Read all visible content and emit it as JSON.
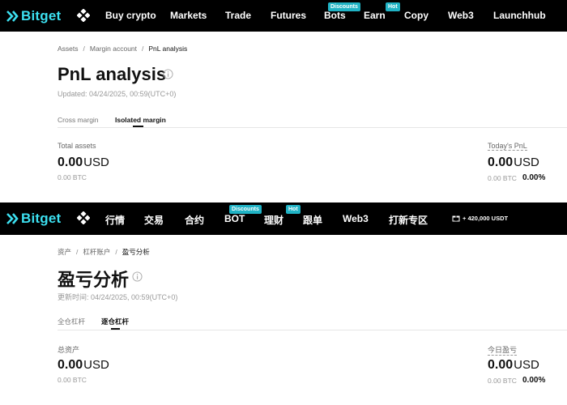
{
  "brand": {
    "name": "Bitget",
    "accent_color": "#3ce0f0",
    "badge_color": "#20b3c5"
  },
  "english": {
    "nav": {
      "items": [
        "Buy crypto",
        "Markets",
        "Trade",
        "Futures",
        "Bots",
        "Earn",
        "Copy",
        "Web3",
        "Launchhub"
      ],
      "bots_badge": "Discounts",
      "earn_badge": "Hot"
    },
    "breadcrumb": [
      "Assets",
      "Margin account",
      "PnL analysis"
    ],
    "title": "PnL analysis",
    "updated": "Updated: 04/24/2025, 00:59(UTC+0)",
    "tabs": [
      "Cross margin",
      "Isolated margin"
    ],
    "active_tab": "Isolated margin",
    "total_assets": {
      "label": "Total assets",
      "value": "0.00",
      "unit": "USD",
      "btc": "0.00 BTC"
    },
    "todays_pnl": {
      "label": "Today's PnL",
      "value": "0.00",
      "unit": "USD",
      "btc": "0.00 BTC",
      "percent": "0.00%"
    }
  },
  "chinese": {
    "nav": {
      "items": [
        "行情",
        "交易",
        "合约",
        "BOT",
        "理财",
        "跟单",
        "Web3",
        "打新专区"
      ],
      "bot_badge": "Discounts",
      "earn_badge": "Hot",
      "promo": "+ 420,000 USDT"
    },
    "breadcrumb": [
      "资产",
      "杠杆账户",
      "盈亏分析"
    ],
    "title": "盈亏分析",
    "updated": "更新时间: 04/24/2025, 00:59(UTC+0)",
    "tabs": [
      "全仓杠杆",
      "逐仓杠杆"
    ],
    "active_tab": "逐仓杠杆",
    "total_assets": {
      "label": "总资产",
      "value": "0.00",
      "unit": "USD",
      "btc": "0.00 BTC"
    },
    "todays_pnl": {
      "label": "今日盈亏",
      "value": "0.00",
      "unit": "USD",
      "btc": "0.00 BTC",
      "percent": "0.00%"
    }
  }
}
